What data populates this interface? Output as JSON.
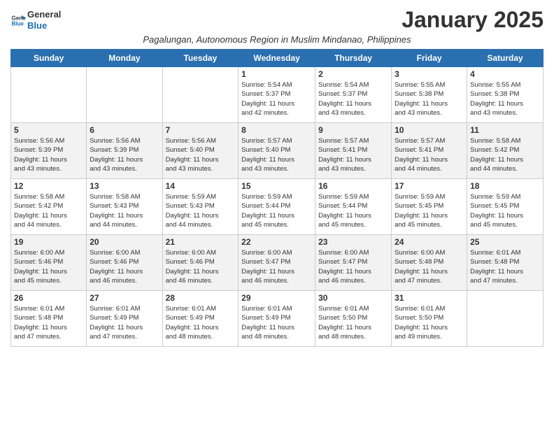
{
  "header": {
    "logo_line1": "General",
    "logo_line2": "Blue",
    "title": "January 2025",
    "subtitle": "Pagalungan, Autonomous Region in Muslim Mindanao, Philippines"
  },
  "weekdays": [
    "Sunday",
    "Monday",
    "Tuesday",
    "Wednesday",
    "Thursday",
    "Friday",
    "Saturday"
  ],
  "weeks": [
    [
      {
        "day": "",
        "info": ""
      },
      {
        "day": "",
        "info": ""
      },
      {
        "day": "",
        "info": ""
      },
      {
        "day": "1",
        "info": "Sunrise: 5:54 AM\nSunset: 5:37 PM\nDaylight: 11 hours\nand 42 minutes."
      },
      {
        "day": "2",
        "info": "Sunrise: 5:54 AM\nSunset: 5:37 PM\nDaylight: 11 hours\nand 43 minutes."
      },
      {
        "day": "3",
        "info": "Sunrise: 5:55 AM\nSunset: 5:38 PM\nDaylight: 11 hours\nand 43 minutes."
      },
      {
        "day": "4",
        "info": "Sunrise: 5:55 AM\nSunset: 5:38 PM\nDaylight: 11 hours\nand 43 minutes."
      }
    ],
    [
      {
        "day": "5",
        "info": "Sunrise: 5:56 AM\nSunset: 5:39 PM\nDaylight: 11 hours\nand 43 minutes."
      },
      {
        "day": "6",
        "info": "Sunrise: 5:56 AM\nSunset: 5:39 PM\nDaylight: 11 hours\nand 43 minutes."
      },
      {
        "day": "7",
        "info": "Sunrise: 5:56 AM\nSunset: 5:40 PM\nDaylight: 11 hours\nand 43 minutes."
      },
      {
        "day": "8",
        "info": "Sunrise: 5:57 AM\nSunset: 5:40 PM\nDaylight: 11 hours\nand 43 minutes."
      },
      {
        "day": "9",
        "info": "Sunrise: 5:57 AM\nSunset: 5:41 PM\nDaylight: 11 hours\nand 43 minutes."
      },
      {
        "day": "10",
        "info": "Sunrise: 5:57 AM\nSunset: 5:41 PM\nDaylight: 11 hours\nand 44 minutes."
      },
      {
        "day": "11",
        "info": "Sunrise: 5:58 AM\nSunset: 5:42 PM\nDaylight: 11 hours\nand 44 minutes."
      }
    ],
    [
      {
        "day": "12",
        "info": "Sunrise: 5:58 AM\nSunset: 5:42 PM\nDaylight: 11 hours\nand 44 minutes."
      },
      {
        "day": "13",
        "info": "Sunrise: 5:58 AM\nSunset: 5:43 PM\nDaylight: 11 hours\nand 44 minutes."
      },
      {
        "day": "14",
        "info": "Sunrise: 5:59 AM\nSunset: 5:43 PM\nDaylight: 11 hours\nand 44 minutes."
      },
      {
        "day": "15",
        "info": "Sunrise: 5:59 AM\nSunset: 5:44 PM\nDaylight: 11 hours\nand 45 minutes."
      },
      {
        "day": "16",
        "info": "Sunrise: 5:59 AM\nSunset: 5:44 PM\nDaylight: 11 hours\nand 45 minutes."
      },
      {
        "day": "17",
        "info": "Sunrise: 5:59 AM\nSunset: 5:45 PM\nDaylight: 11 hours\nand 45 minutes."
      },
      {
        "day": "18",
        "info": "Sunrise: 5:59 AM\nSunset: 5:45 PM\nDaylight: 11 hours\nand 45 minutes."
      }
    ],
    [
      {
        "day": "19",
        "info": "Sunrise: 6:00 AM\nSunset: 5:46 PM\nDaylight: 11 hours\nand 45 minutes."
      },
      {
        "day": "20",
        "info": "Sunrise: 6:00 AM\nSunset: 5:46 PM\nDaylight: 11 hours\nand 46 minutes."
      },
      {
        "day": "21",
        "info": "Sunrise: 6:00 AM\nSunset: 5:46 PM\nDaylight: 11 hours\nand 46 minutes."
      },
      {
        "day": "22",
        "info": "Sunrise: 6:00 AM\nSunset: 5:47 PM\nDaylight: 11 hours\nand 46 minutes."
      },
      {
        "day": "23",
        "info": "Sunrise: 6:00 AM\nSunset: 5:47 PM\nDaylight: 11 hours\nand 46 minutes."
      },
      {
        "day": "24",
        "info": "Sunrise: 6:00 AM\nSunset: 5:48 PM\nDaylight: 11 hours\nand 47 minutes."
      },
      {
        "day": "25",
        "info": "Sunrise: 6:01 AM\nSunset: 5:48 PM\nDaylight: 11 hours\nand 47 minutes."
      }
    ],
    [
      {
        "day": "26",
        "info": "Sunrise: 6:01 AM\nSunset: 5:48 PM\nDaylight: 11 hours\nand 47 minutes."
      },
      {
        "day": "27",
        "info": "Sunrise: 6:01 AM\nSunset: 5:49 PM\nDaylight: 11 hours\nand 47 minutes."
      },
      {
        "day": "28",
        "info": "Sunrise: 6:01 AM\nSunset: 5:49 PM\nDaylight: 11 hours\nand 48 minutes."
      },
      {
        "day": "29",
        "info": "Sunrise: 6:01 AM\nSunset: 5:49 PM\nDaylight: 11 hours\nand 48 minutes."
      },
      {
        "day": "30",
        "info": "Sunrise: 6:01 AM\nSunset: 5:50 PM\nDaylight: 11 hours\nand 48 minutes."
      },
      {
        "day": "31",
        "info": "Sunrise: 6:01 AM\nSunset: 5:50 PM\nDaylight: 11 hours\nand 49 minutes."
      },
      {
        "day": "",
        "info": ""
      }
    ]
  ]
}
